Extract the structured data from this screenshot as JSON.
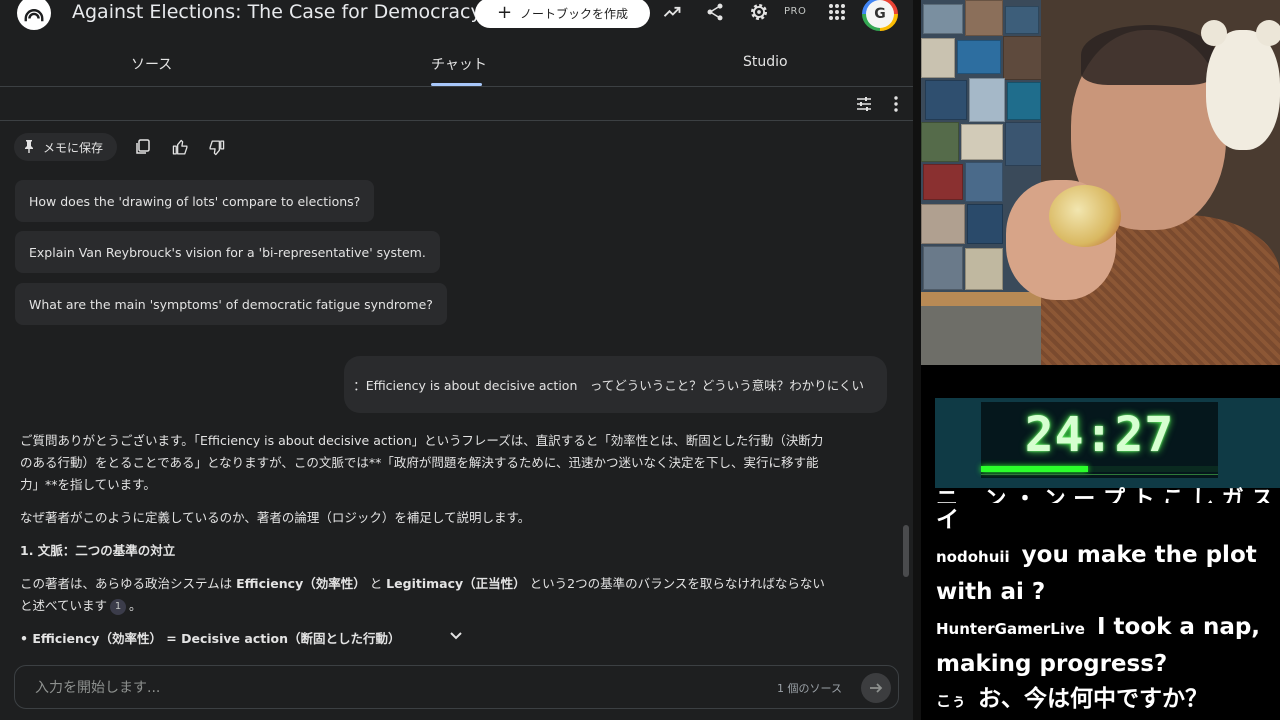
{
  "app": {
    "title": "Against Elections: The Case for Democracy",
    "create_notebook_label": "ノートブックを作成",
    "pro_badge": "PRO",
    "avatar_letter": "G"
  },
  "tabs": [
    {
      "label": "ソース",
      "active": false
    },
    {
      "label": "チャット",
      "active": true
    },
    {
      "label": "Studio",
      "active": false
    }
  ],
  "actions": {
    "save_memo_label": "メモに保存"
  },
  "suggestions": [
    "How does the 'drawing of lots' compare to elections?",
    "Explain Van Reybrouck's vision for a 'bi-representative' system.",
    "What are the main 'symptoms' of democratic fatigue syndrome?"
  ],
  "user_message": "：Efficiency is about decisive action　ってどういうこと？どういう意味？わかりにくい",
  "answer": {
    "p1": "ご質問ありがとうございます。「Efficiency is about decisive action」というフレーズは、直訳すると「効率性とは、断固とした行動（決断力のある行動）をとることである」となりますが、この文脈では**「政府が問題を解決するために、迅速かつ迷いなく決定を下し、実行に移す能力」**を指しています。",
    "p2": "なぜ著者がこのように定義しているのか、著者の論理（ロジック）を補足して説明します。",
    "h1": "1. 文脈：二つの基準の対立",
    "p3_pre": "この著者は、あらゆる政治システムは ",
    "p3_b1": "Efficiency（効率性）",
    "p3_mid": " と ",
    "p3_b2": "Legitimacy（正当性）",
    "p3_post": " という2つの基準のバランスを取らなければならないと述べています",
    "p3_cite": "1",
    "p3_end": "。",
    "bullet": "• Efficiency（効率性） = Decisive action（断固とした行動）"
  },
  "input": {
    "placeholder": "入力を開始します...",
    "source_count": "1 個のソース"
  },
  "timer": {
    "time": "24:27",
    "progress": 0.45
  },
  "chat": {
    "cut_line": "ニ _ ン ・ ン ー プ ト こ し ガ ス ン ン ン ノ",
    "lines": [
      {
        "user": "",
        "text": "イ"
      },
      {
        "user": "nodohuii",
        "text": "you make the plot with ai ?"
      },
      {
        "user": "HunterGamerLive",
        "text": "I took a nap, making progress?"
      },
      {
        "user": "こぅ",
        "text": "お、今は何中ですか？"
      }
    ]
  },
  "colors": {
    "bg": "#1e1f20",
    "accent": "#a8c7fa",
    "timer_green": "#2bff2b"
  }
}
